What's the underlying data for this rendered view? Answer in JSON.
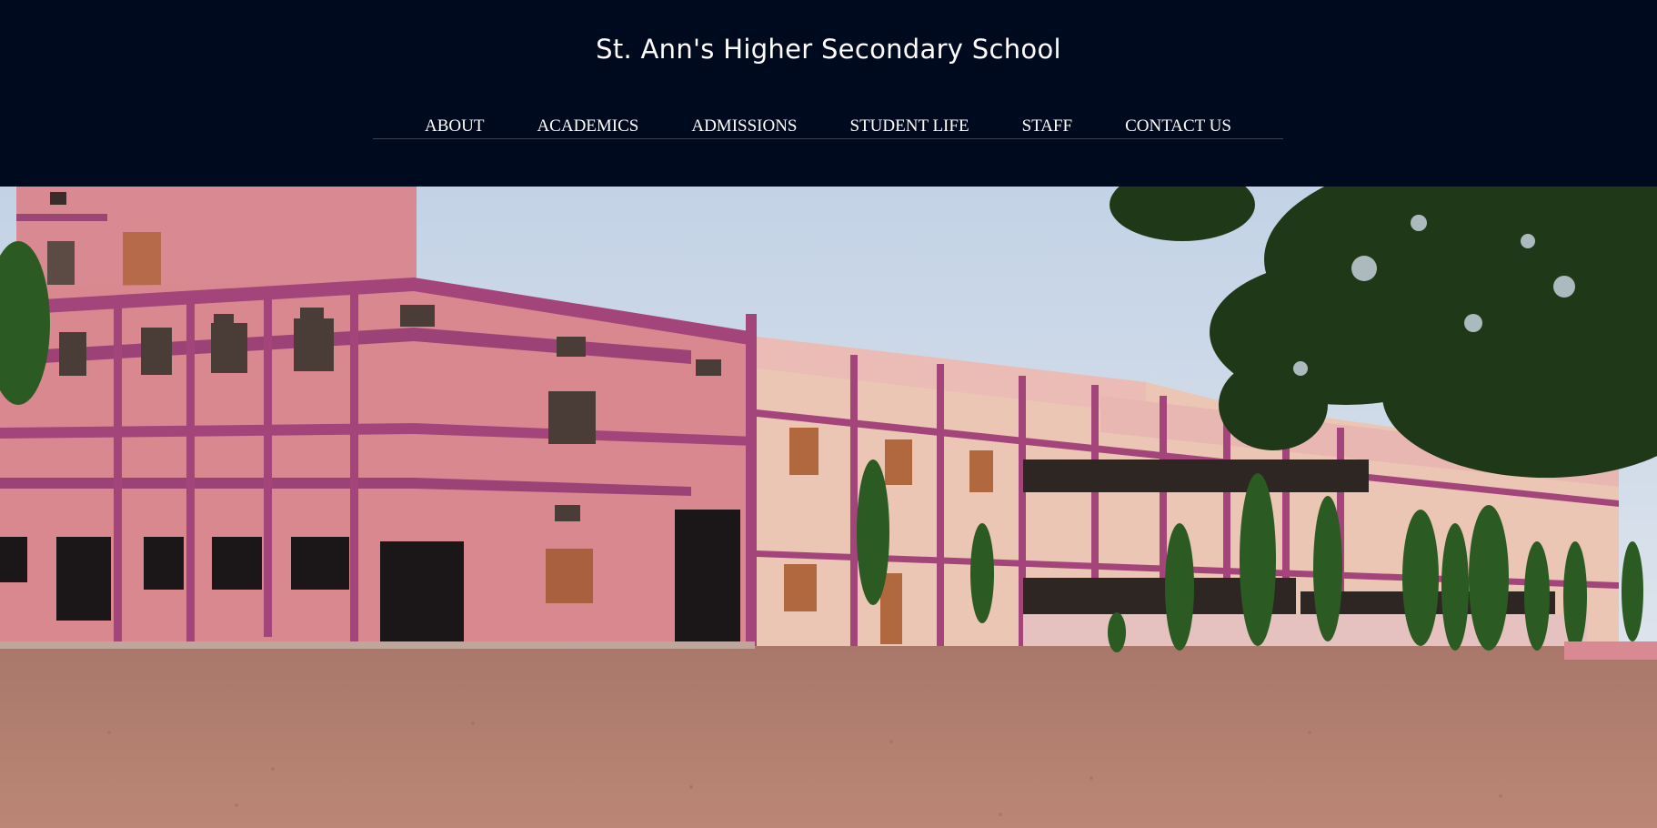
{
  "header": {
    "site_title": "St. Ann's Higher Secondary School"
  },
  "nav": {
    "items": [
      {
        "label": "ABOUT"
      },
      {
        "label": "ACADEMICS"
      },
      {
        "label": "ADMISSIONS"
      },
      {
        "label": "STUDENT LIFE"
      },
      {
        "label": "STAFF"
      },
      {
        "label": "CONTACT US"
      }
    ]
  },
  "hero": {
    "image_subject": "school-building-photo"
  },
  "colors": {
    "header_bg": "#000a1f",
    "text": "#ffffff",
    "building_pink": "#d98a8f",
    "building_trim": "#8a3a6e",
    "ground": "#b98473",
    "sky": "#cfdbe8"
  }
}
